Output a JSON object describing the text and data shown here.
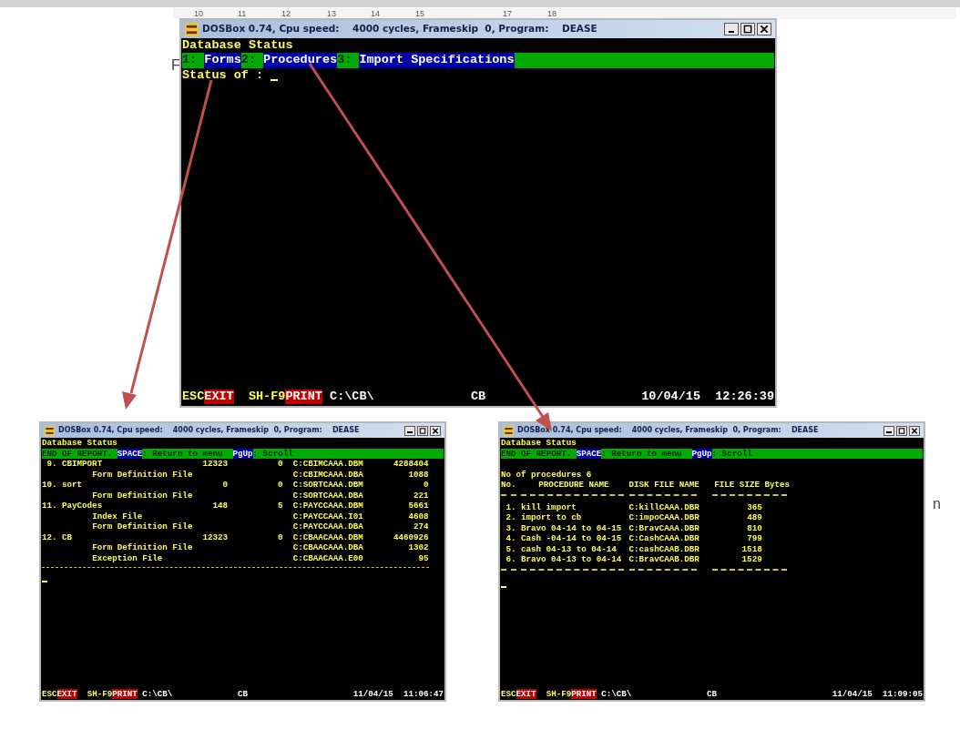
{
  "document": {
    "ruler": [
      "10",
      "11",
      "12",
      "13",
      "14",
      "15",
      "17",
      "18"
    ],
    "fragments": [
      {
        "text": "F"
      },
      {
        "text": "n"
      }
    ]
  },
  "windows": [
    {
      "kind": "menu",
      "title": "DOSBox 0.74, Cpu speed:    4000 cycles, Frameskip  0, Program:    DEASE",
      "heading": "Database Status",
      "menu": [
        {
          "key": "1:",
          "label": "Forms"
        },
        {
          "key": "2:",
          "label": "Procedures"
        },
        {
          "key": "3:",
          "label": "Import Specifications"
        }
      ],
      "prompt": "Status of :",
      "status_bar": {
        "esc_key": "ESC",
        "esc_action": "EXIT",
        "print_key": "SH-F9",
        "print_action": "PRINT",
        "path": "C:\\CB\\",
        "database": "CB",
        "date": "10/04/15",
        "time": "12:26:39"
      }
    },
    {
      "kind": "forms_report",
      "title": "DOSBox 0.74, Cpu speed:    4000 cycles, Frameskip  0, Program:    DEASE",
      "heading": "Database Status",
      "prompt_bar": [
        {
          "kind": "text",
          "text": "END OF REPORT."
        },
        {
          "kind": "key",
          "text": "SPACE"
        },
        {
          "kind": "text",
          "text": ": Return to menu"
        },
        {
          "kind": "key",
          "text": "PgUp"
        },
        {
          "kind": "text",
          "text": ": Scroll"
        }
      ],
      "rows": [
        {
          "kind": "entry",
          "number": "9.",
          "name": "CBIMPORT",
          "records": "12323",
          "column_3": "0",
          "file": "C:CBIMCAAA.DBM",
          "size": "4288404"
        },
        {
          "kind": "sub",
          "name": "Form Definition File",
          "file": "C:CBIMCAAA.DBA",
          "size": "1088"
        },
        {
          "kind": "entry",
          "number": "10.",
          "name": "sort",
          "records": "0",
          "column_3": "0",
          "file": "C:SORTCAAA.DBM",
          "size": "0"
        },
        {
          "kind": "sub",
          "name": "Form Definition File",
          "file": "C:SORTCAAA.DBA",
          "size": "221"
        },
        {
          "kind": "entry",
          "number": "11.",
          "name": "PayCodes",
          "records": "148",
          "column_3": "5",
          "file": "C:PAYCCAAA.DBM",
          "size": "5661"
        },
        {
          "kind": "sub",
          "name": "Index File",
          "file": "C:PAYCCAAA.I01",
          "size": "4608"
        },
        {
          "kind": "sub",
          "name": "Form Definition File",
          "file": "C:PAYCCAAA.DBA",
          "size": "274"
        },
        {
          "kind": "entry",
          "number": "12.",
          "name": "CB",
          "records": "12323",
          "column_3": "0",
          "file": "C:CBAACAAA.DBM",
          "size": "4460926"
        },
        {
          "kind": "sub",
          "name": "Form Definition File",
          "file": "C:CBAACAAA.DBA",
          "size": "1302"
        },
        {
          "kind": "sub",
          "name": "Exception File",
          "file": "C:CBAACAAA.E00",
          "size": "95"
        }
      ],
      "status_bar": {
        "esc_key": "ESC",
        "esc_action": "EXIT",
        "print_key": "SH-F9",
        "print_action": "PRINT",
        "path": "C:\\CB\\",
        "database": "CB",
        "date": "11/04/15",
        "time": "11:06:47"
      }
    },
    {
      "kind": "procedures_report",
      "title": "DOSBox 0.74, Cpu speed:    4000 cycles, Frameskip  0, Program:    DEASE",
      "heading": "Database Status",
      "prompt_bar": [
        {
          "kind": "text",
          "text": "END OF REPORT."
        },
        {
          "kind": "key",
          "text": "SPACE"
        },
        {
          "kind": "text",
          "text": ": Return to menu"
        },
        {
          "kind": "key",
          "text": "PgUp"
        },
        {
          "kind": "text",
          "text": ": Scroll"
        }
      ],
      "count_line": "No of procedures 6",
      "columns": [
        "No.",
        "PROCEDURE NAME",
        "DISK FILE NAME",
        "FILE SIZE Bytes"
      ],
      "rows": [
        {
          "number": "1.",
          "name": "kill import",
          "file": "C:killCAAA.DBR",
          "size": "365"
        },
        {
          "number": "2.",
          "name": "import to cb",
          "file": "C:impoCAAA.DBR",
          "size": "489"
        },
        {
          "number": "3.",
          "name": "Bravo 04-14 to 04-15",
          "file": "C:BravCAAA.DBR",
          "size": "810"
        },
        {
          "number": "4.",
          "name": "Cash -04-14 to 04-15",
          "file": "C:CashCAAA.DBR",
          "size": "799"
        },
        {
          "number": "5.",
          "name": "cash 04-13 to 04-14",
          "file": "C:cashCAAB.DBR",
          "size": "1518"
        },
        {
          "number": "6.",
          "name": "Bravo 04-13 to 04-14",
          "file": "C:BravCAAB.DBR",
          "size": "1529"
        }
      ],
      "status_bar": {
        "esc_key": "ESC",
        "esc_action": "EXIT",
        "print_key": "SH-F9",
        "print_action": "PRINT",
        "path": "C:\\CB\\",
        "database": "CB",
        "date": "11/04/15",
        "time": "11:09:05"
      }
    }
  ]
}
